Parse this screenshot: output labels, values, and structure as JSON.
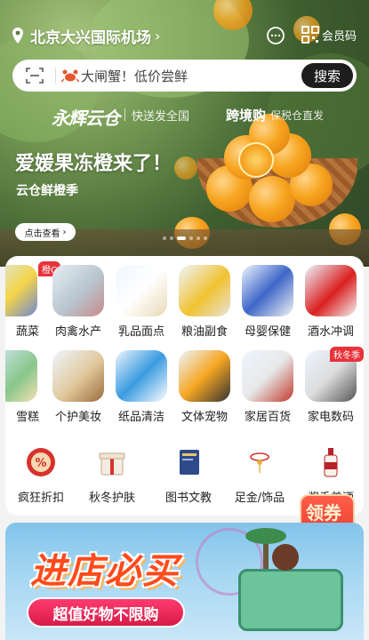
{
  "header": {
    "location": "北京大兴国际机场",
    "member_label": "会员码"
  },
  "search": {
    "placeholder_text": "大闸蟹！低价尝鲜",
    "button_label": "搜索"
  },
  "hero": {
    "brand_name": "永辉云仓",
    "brand_tagline": "快送发全国",
    "crossborder_label": "跨境购",
    "crossborder_sub": "保税仓直发",
    "promo_title": "爱媛果冻橙来了！",
    "promo_subtitle": "云仓鲜橙季",
    "promo_button": "点击查看",
    "carousel_count": 6,
    "carousel_active": 2
  },
  "categories": {
    "row1": [
      {
        "label": "蔬菜",
        "badge": "橙C"
      },
      {
        "label": "肉禽水产"
      },
      {
        "label": "乳品面点"
      },
      {
        "label": "粮油副食"
      },
      {
        "label": "母婴保健"
      },
      {
        "label": "酒水冲调"
      }
    ],
    "row2": [
      {
        "label": "雪糕"
      },
      {
        "label": "个护美妆"
      },
      {
        "label": "纸品清洁"
      },
      {
        "label": "文体宠物"
      },
      {
        "label": "家居百货"
      },
      {
        "label": "家电数码",
        "badge": "秋冬季"
      }
    ]
  },
  "services": [
    {
      "label": "疯狂折扣"
    },
    {
      "label": "秋冬护肤"
    },
    {
      "label": "图书文教"
    },
    {
      "label": "足金/饰品"
    },
    {
      "label": "酱香美酒"
    }
  ],
  "coupon": {
    "label": "领券"
  },
  "bottom_banner": {
    "title": "进店必买",
    "subtitle": "超值好物不限购"
  },
  "colors": {
    "accent_red": "#e8333a",
    "search_button": "#1d1d1d"
  }
}
